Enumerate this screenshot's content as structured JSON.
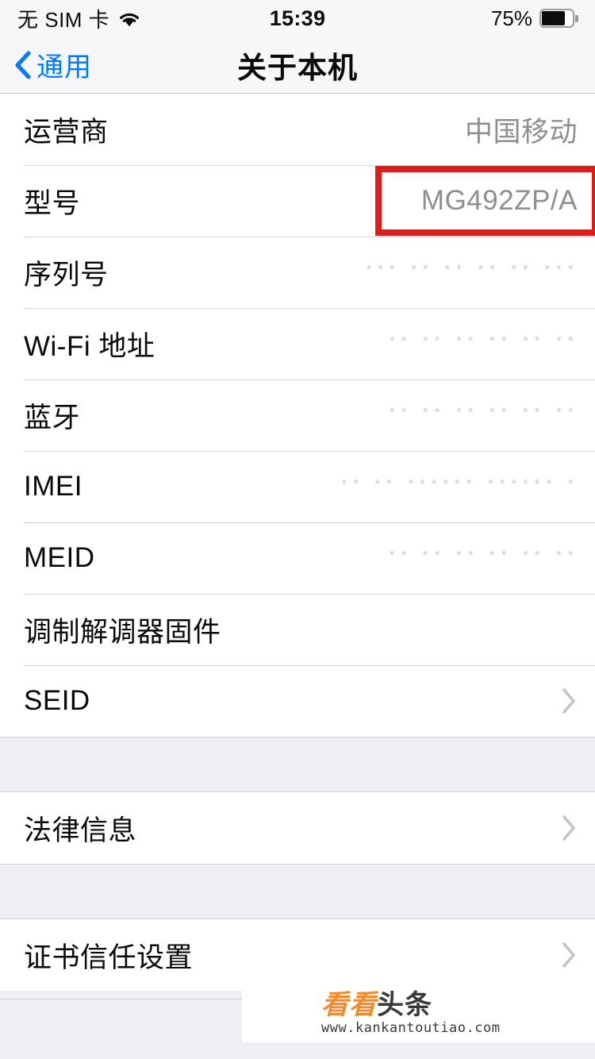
{
  "status_bar": {
    "carrier": "无 SIM 卡",
    "wifi_icon": "wifi-icon",
    "time": "15:39",
    "battery_percent": "75%",
    "battery_level": 75,
    "battery_icon": "battery-icon"
  },
  "nav_bar": {
    "back_label": "通用",
    "back_icon": "chevron-left-icon",
    "title": "关于本机"
  },
  "highlight": {
    "color": "#e01b1b",
    "target_row": "型号"
  },
  "sections": [
    {
      "rows": [
        {
          "label": "运营商",
          "value": "中国移动",
          "redacted": false,
          "chevron": false
        },
        {
          "label": "型号",
          "value": "MG492ZP/A",
          "redacted": false,
          "chevron": false,
          "highlighted": true
        },
        {
          "label": "序列号",
          "value": "··· ·· ·· ·· ·· ···",
          "redacted": true,
          "chevron": false
        },
        {
          "label": "Wi-Fi 地址",
          "value": "·· ·· ·· ·· ·· ··",
          "redacted": true,
          "chevron": false
        },
        {
          "label": "蓝牙",
          "value": "·· ·· ·· ·· ·· ··",
          "redacted": true,
          "chevron": false
        },
        {
          "label": "IMEI",
          "value": "·· ·· ······ ······ ·",
          "redacted": true,
          "chevron": false
        },
        {
          "label": "MEID",
          "value": "·· ·· ·· ·· ·· ··",
          "redacted": true,
          "chevron": false
        },
        {
          "label": "调制解调器固件",
          "value": "",
          "redacted": false,
          "chevron": false
        },
        {
          "label": "SEID",
          "value": "",
          "redacted": false,
          "chevron": true
        }
      ]
    },
    {
      "rows": [
        {
          "label": "法律信息",
          "value": "",
          "redacted": false,
          "chevron": true
        }
      ]
    },
    {
      "rows": [
        {
          "label": "证书信任设置",
          "value": "",
          "redacted": false,
          "chevron": true
        }
      ]
    }
  ],
  "watermark": {
    "logo_orange": "看看",
    "logo_dark": "头条",
    "url": "www.kankantoutiao.com"
  },
  "colors": {
    "accent_blue": "#007aff",
    "value_gray": "#8e8e93",
    "group_gap": "#efeef3",
    "highlight_red": "#e01b1b",
    "logo_orange": "#f08c2e"
  }
}
